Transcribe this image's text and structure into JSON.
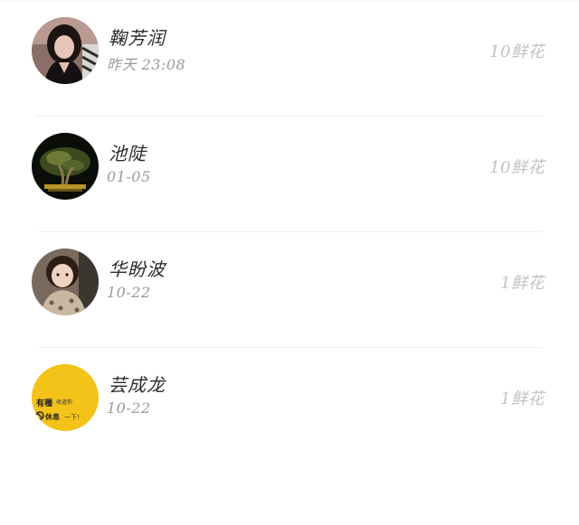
{
  "contacts": [
    {
      "name": "鞠芳润",
      "time": "昨天 23:08",
      "flowers": "10鲜花",
      "avatar": "woman-portrait"
    },
    {
      "name": "池陡",
      "time": "01-05",
      "flowers": "10鲜花",
      "avatar": "bonsai-tree"
    },
    {
      "name": "华盼波",
      "time": "10-22",
      "flowers": "1鲜花",
      "avatar": "child-photo"
    },
    {
      "name": "芸成龙",
      "time": "10-22",
      "flowers": "1鲜花",
      "avatar": "yellow-text-badge"
    }
  ],
  "yellow_avatar_text": {
    "line1": "有種",
    "line1_small": "收道你",
    "line2": "休息",
    "line2_small": "一下！"
  }
}
